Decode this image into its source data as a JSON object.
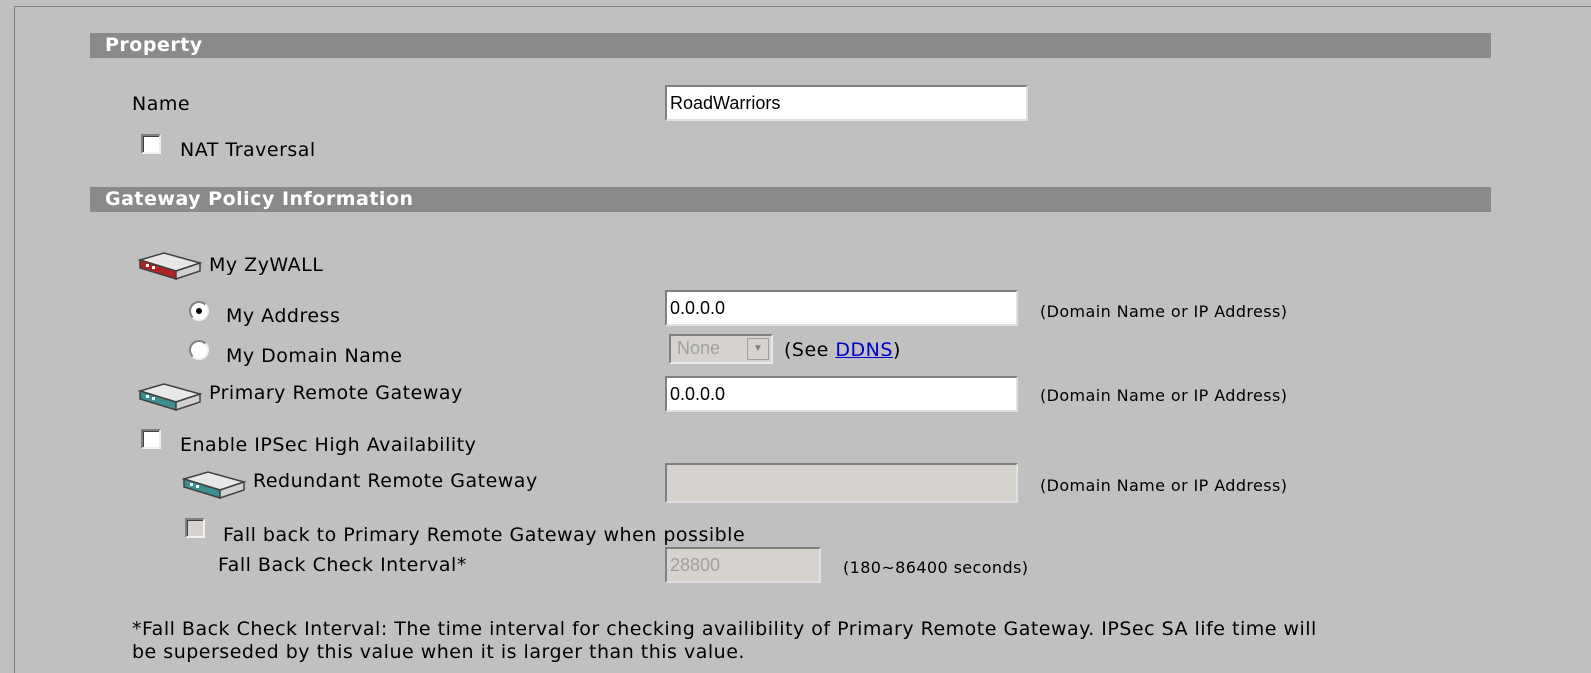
{
  "property": {
    "header": "Property",
    "name_label": "Name",
    "name_value": "RoadWarriors",
    "nat_traversal_label": "NAT Traversal",
    "nat_traversal_checked": false
  },
  "gateway": {
    "header": "Gateway Policy Information",
    "my_zywall_label": "My ZyWALL",
    "my_address_label": "My Address",
    "my_address_value": "0.0.0.0",
    "my_address_hint": "(Domain Name or IP Address)",
    "my_domain_label": "My Domain Name",
    "my_domain_select": "None",
    "see_prefix": "(See ",
    "ddns_link": "DDNS",
    "see_suffix": ")",
    "primary_label": "Primary Remote Gateway",
    "primary_value": "0.0.0.0",
    "primary_hint": "(Domain Name or IP Address)",
    "ha_label": "Enable IPSec High Availability",
    "redundant_label": "Redundant Remote Gateway",
    "redundant_value": "",
    "redundant_hint": "(Domain Name or IP Address)",
    "fallback_label": "Fall back to Primary Remote Gateway when possible",
    "interval_label": "Fall Back Check Interval*",
    "interval_value": "28800",
    "interval_hint": "(180~86400 seconds)",
    "footnote_line1": "*Fall Back Check Interval: The time interval for checking availibility of Primary Remote Gateway. IPSec SA life time will",
    "footnote_line2": "be superseded by this value when it is larger than this value."
  },
  "colors": {
    "background": "#c0c0c0",
    "header_bg": "#8a8a8a",
    "link": "#0000cc"
  }
}
